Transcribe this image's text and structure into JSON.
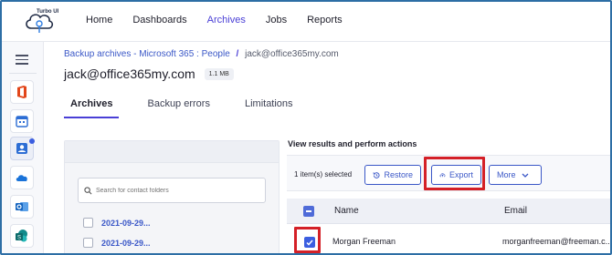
{
  "app": {
    "logo_text": "Turbo UI"
  },
  "topnav": {
    "items": [
      {
        "label": "Home",
        "active": false
      },
      {
        "label": "Dashboards",
        "active": false
      },
      {
        "label": "Archives",
        "active": true
      },
      {
        "label": "Jobs",
        "active": false
      },
      {
        "label": "Reports",
        "active": false
      }
    ]
  },
  "rail": {
    "icons": [
      "menu-icon",
      "office-icon",
      "calendar-icon",
      "contacts-icon",
      "onedrive-icon",
      "outlook-icon",
      "sharepoint-icon"
    ]
  },
  "breadcrumb": {
    "link": "Backup archives - Microsoft 365 : People",
    "separator": "/",
    "current": "jack@office365my.com"
  },
  "page": {
    "title": "jack@office365my.com",
    "size_badge": "1.1 MB"
  },
  "tabs": [
    {
      "label": "Archives",
      "active": true
    },
    {
      "label": "Backup errors",
      "active": false
    },
    {
      "label": "Limitations",
      "active": false
    }
  ],
  "folders": {
    "search_placeholder": "Search for contact folders",
    "items": [
      {
        "label": "2021-09-29..."
      },
      {
        "label": "2021-09-29..."
      }
    ]
  },
  "results": {
    "title": "View results and perform actions",
    "selected_text": "1 item(s) selected",
    "restore_label": "Restore",
    "export_label": "Export",
    "more_label": "More"
  },
  "table": {
    "columns": {
      "name": "Name",
      "email": "Email"
    },
    "rows": [
      {
        "name": "Morgan Freeman",
        "email": "morganfreeman@freeman.c...",
        "checked": true
      }
    ]
  },
  "colors": {
    "accent": "#4a3fd6",
    "link": "#3a57c7",
    "highlight": "#d42027",
    "frame": "#2d6ea5"
  }
}
